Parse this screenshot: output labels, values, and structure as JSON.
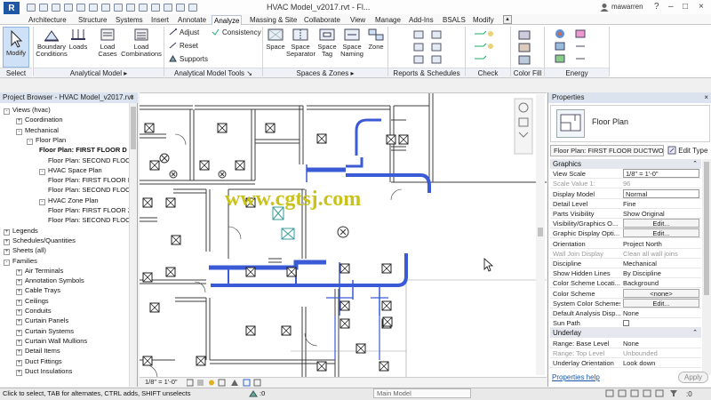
{
  "app": {
    "logo_letter": "R",
    "title": "HVAC Model_v2017.rvt - Fl...",
    "user": "mawarren"
  },
  "tabs": [
    "Architecture",
    "Structure",
    "Systems",
    "Insert",
    "Annotate",
    "Analyze",
    "Massing & Site",
    "Collaborate",
    "View",
    "Manage",
    "Add-Ins",
    "BSALS",
    "Modify"
  ],
  "active_tab": "Analyze",
  "ribbon": {
    "modify": "Modify",
    "select": "Select",
    "analytical_model": {
      "label": "Analytical Model",
      "buttons": [
        "Boundary Conditions",
        "Loads",
        "Load Cases",
        "Load Combinations"
      ]
    },
    "analytical_tools": {
      "label": "Analytical Model Tools",
      "items": [
        "Adjust",
        "Reset",
        "Supports",
        "Consistency"
      ]
    },
    "spaces_zones": {
      "label": "Spaces & Zones",
      "buttons": [
        "Space",
        "Space Separator",
        "Space Tag",
        "Space Naming",
        "Zone"
      ]
    },
    "reports": {
      "label": "Reports & Schedules"
    },
    "check_systems": {
      "label": "Check Systems"
    },
    "color_fill": {
      "label": "Color Fill"
    },
    "energy": {
      "label": "Energy Optimization"
    }
  },
  "project_browser": {
    "header": "Project Browser - HVAC Model_v2017.rvt",
    "rows": [
      {
        "t": "Views (hvac)",
        "toggle": "-"
      },
      {
        "t": "Coordination",
        "toggle": "+"
      },
      {
        "t": "Mechanical",
        "toggle": "-"
      },
      {
        "t": "Floor Plan",
        "toggle": "-"
      },
      {
        "t": "Floor Plan: FIRST FLOOR D",
        "toggle": ""
      },
      {
        "t": "Floor Plan: SECOND FLOOR",
        "toggle": ""
      },
      {
        "t": "HVAC Space Plan",
        "toggle": "-"
      },
      {
        "t": "Floor Plan: FIRST FLOOR M",
        "toggle": ""
      },
      {
        "t": "Floor Plan: SECOND FLOOR",
        "toggle": ""
      },
      {
        "t": "HVAC Zone Plan",
        "toggle": "-"
      },
      {
        "t": "Floor Plan: FIRST FLOOR ZC",
        "toggle": ""
      },
      {
        "t": "Floor Plan: SECOND FLOOR",
        "toggle": ""
      },
      {
        "t": "Legends",
        "toggle": "+"
      },
      {
        "t": "Schedules/Quantities",
        "toggle": "+"
      },
      {
        "t": "Sheets (all)",
        "toggle": "+"
      },
      {
        "t": "Families",
        "toggle": "-"
      },
      {
        "t": "Air Terminals",
        "toggle": "+"
      },
      {
        "t": "Annotation Symbols",
        "toggle": "+"
      },
      {
        "t": "Cable Trays",
        "toggle": "+"
      },
      {
        "t": "Ceilings",
        "toggle": "+"
      },
      {
        "t": "Conduits",
        "toggle": "+"
      },
      {
        "t": "Curtain Panels",
        "toggle": "+"
      },
      {
        "t": "Curtain Systems",
        "toggle": "+"
      },
      {
        "t": "Curtain Wall Mullions",
        "toggle": "+"
      },
      {
        "t": "Detail Items",
        "toggle": "+"
      },
      {
        "t": "Duct Fittings",
        "toggle": "+"
      },
      {
        "t": "Duct Insulations",
        "toggle": "+"
      }
    ]
  },
  "canvas": {
    "watermark": "www.cgtsj.com",
    "scale": "1/8\" = 1'-0\""
  },
  "properties": {
    "header": "Properties",
    "type_name": "Floor Plan",
    "type_selector": "Floor Plan: FIRST FLOOR DUCTWOI",
    "edit_type": "Edit Type",
    "groups": [
      {
        "name": "Graphics",
        "rows": [
          {
            "k": "View Scale",
            "v": "1/8\" = 1'-0\"",
            "kind": "input"
          },
          {
            "k": "Scale Value    1:",
            "v": "96",
            "kind": "dim"
          },
          {
            "k": "Display Model",
            "v": "Normal",
            "kind": "input"
          },
          {
            "k": "Detail Level",
            "v": "Fine",
            "kind": "text"
          },
          {
            "k": "Parts Visibility",
            "v": "Show Original",
            "kind": "text"
          },
          {
            "k": "Visibility/Graphics O...",
            "v": "Edit...",
            "kind": "button"
          },
          {
            "k": "Graphic Display Opti...",
            "v": "Edit...",
            "kind": "button"
          },
          {
            "k": "Orientation",
            "v": "Project North",
            "kind": "text"
          },
          {
            "k": "Wall Join Display",
            "v": "Clean all wall joins",
            "kind": "dim"
          },
          {
            "k": "Discipline",
            "v": "Mechanical",
            "kind": "text"
          },
          {
            "k": "Show Hidden Lines",
            "v": "By Discipline",
            "kind": "text"
          },
          {
            "k": "Color Scheme Locati...",
            "v": "Background",
            "kind": "text"
          },
          {
            "k": "Color Scheme",
            "v": "<none>",
            "kind": "button"
          },
          {
            "k": "System Color Schemes",
            "v": "Edit...",
            "kind": "button"
          },
          {
            "k": "Default Analysis Disp...",
            "v": "None",
            "kind": "text"
          },
          {
            "k": "Sun Path",
            "v": "",
            "kind": "checkbox"
          }
        ]
      },
      {
        "name": "Underlay",
        "rows": [
          {
            "k": "Range: Base Level",
            "v": "None",
            "kind": "text"
          },
          {
            "k": "Range: Top Level",
            "v": "Unbounded",
            "kind": "dim"
          },
          {
            "k": "Underlay Orientation",
            "v": "Look down",
            "kind": "text"
          }
        ]
      }
    ],
    "help_link": "Properties help",
    "apply": "Apply"
  },
  "status": {
    "text": "Click to select, TAB for alternates, CTRL adds, SHIFT unselects",
    "workset": "Main Model",
    "scale_value": ":0"
  },
  "colors": {
    "accent": "#1d57a6",
    "duct": "#3b5bd6",
    "header": "#dbe3ee"
  }
}
